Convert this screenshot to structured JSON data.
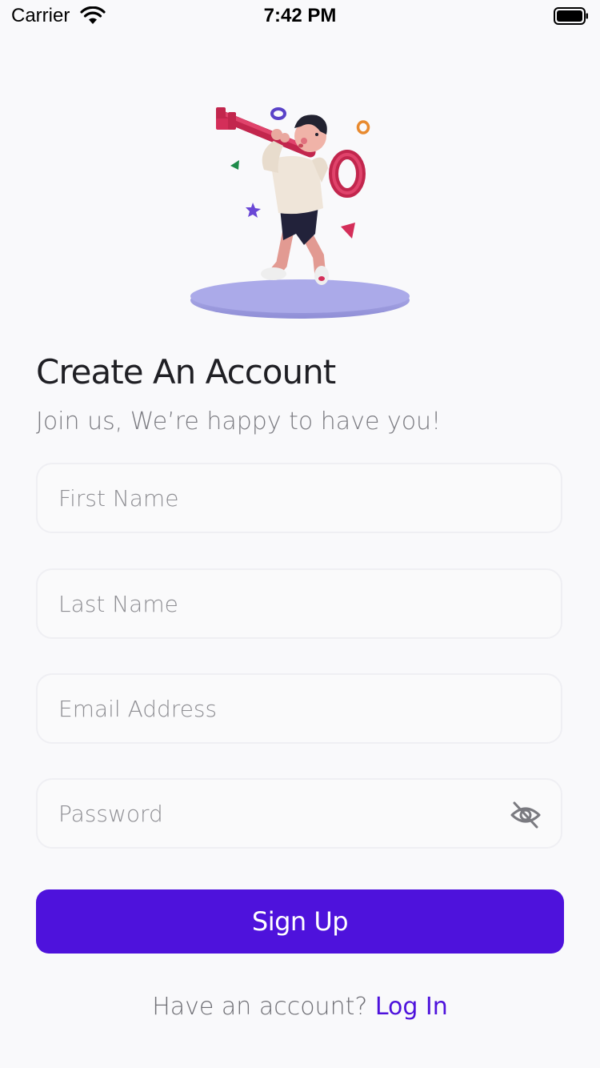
{
  "status_bar": {
    "carrier": "Carrier",
    "time": "7:42 PM",
    "icons": [
      "wifi-icon",
      "battery-icon"
    ]
  },
  "illustration": {
    "icon": "person-carrying-key-illustration",
    "colors": {
      "key": "#d42e59",
      "platform": "#a7a6e6",
      "sweater": "#efe5d9",
      "shorts": "#22223a"
    }
  },
  "header": {
    "title": "Create An Account",
    "subtitle": "Join us, We’re happy to have you!"
  },
  "form": {
    "first_name": {
      "placeholder": "First Name",
      "value": ""
    },
    "last_name": {
      "placeholder": "Last Name",
      "value": ""
    },
    "email": {
      "placeholder": "Email Address",
      "value": ""
    },
    "password": {
      "placeholder": "Password",
      "value": "",
      "toggle_icon": "eye-slash-icon"
    }
  },
  "actions": {
    "signup_label": "Sign Up"
  },
  "footer": {
    "prompt": "Have an account?",
    "login_label": "Log In"
  },
  "colors": {
    "accent": "#4e12dc",
    "background": "#f9f9fb",
    "title_text": "#1f1f24",
    "muted_text": "#7c7c82"
  }
}
